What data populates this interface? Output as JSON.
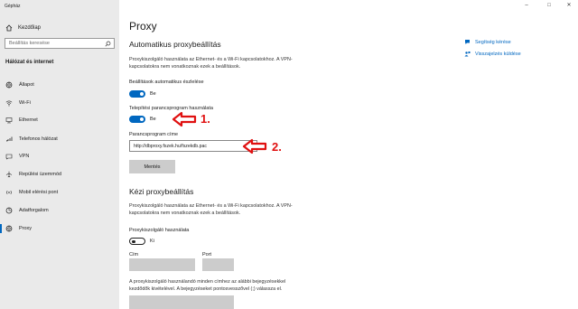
{
  "window": {
    "title": "Gépház"
  },
  "sidebar": {
    "home_label": "Kezdőlap",
    "search_placeholder": "Beállítás keresése",
    "section_title": "Hálózat és internet",
    "items": [
      {
        "label": "Állapot",
        "icon": "globe-icon"
      },
      {
        "label": "Wi-Fi",
        "icon": "wifi-icon"
      },
      {
        "label": "Ethernet",
        "icon": "ethernet-icon"
      },
      {
        "label": "Telefonos hálózat",
        "icon": "phone-icon"
      },
      {
        "label": "VPN",
        "icon": "vpn-icon"
      },
      {
        "label": "Repülési üzemmód",
        "icon": "airplane-icon"
      },
      {
        "label": "Mobil elérési pont",
        "icon": "hotspot-icon"
      },
      {
        "label": "Adatforgalom",
        "icon": "data-usage-icon"
      },
      {
        "label": "Proxy",
        "icon": "globe-icon",
        "active": true
      }
    ]
  },
  "main": {
    "title": "Proxy",
    "auto": {
      "heading": "Automatikus proxybeállítás",
      "description": "Proxykiszolgáló használata az Ethernet- és a Wi-Fi kapcsolatokhoz. A VPN-kapcsolatokra nem vonatkoznak ezek a beállítások.",
      "detect_label": "Beállítások automatikus észlelése",
      "detect_state": "Be",
      "script_label": "Telepítési parancsprogram használata",
      "script_state": "Be",
      "address_label": "Parancsprogram címe",
      "address_value": "http://dbproxy.fszek.hu/fszekdb.pac",
      "save_label": "Mentés"
    },
    "manual": {
      "heading": "Kézi proxybeállítás",
      "description": "Proxykiszolgáló használata az Ethernet- és a Wi-Fi kapcsolatokhoz. A VPN-kapcsolatokra nem vonatkoznak ezek a beállítások.",
      "use_label": "Proxykiszolgáló használata",
      "use_state": "Ki",
      "address_label": "Cím",
      "port_label": "Port",
      "exceptions_description": "A proxykiszolgáló használandó minden címhez az alábbi bejegyzésekkel kezdődők kivételével. A bejegyzéseket pontosvesszővel (;) válassza el."
    }
  },
  "side_links": [
    {
      "label": "Segítség kérése",
      "icon": "help-icon"
    },
    {
      "label": "Visszajelzés küldése",
      "icon": "feedback-icon"
    }
  ],
  "annotations": {
    "first": "1.",
    "second": "2."
  },
  "colors": {
    "accent": "#0067c0",
    "annotation": "#e01010",
    "sidebar_bg": "#eaeaea"
  }
}
